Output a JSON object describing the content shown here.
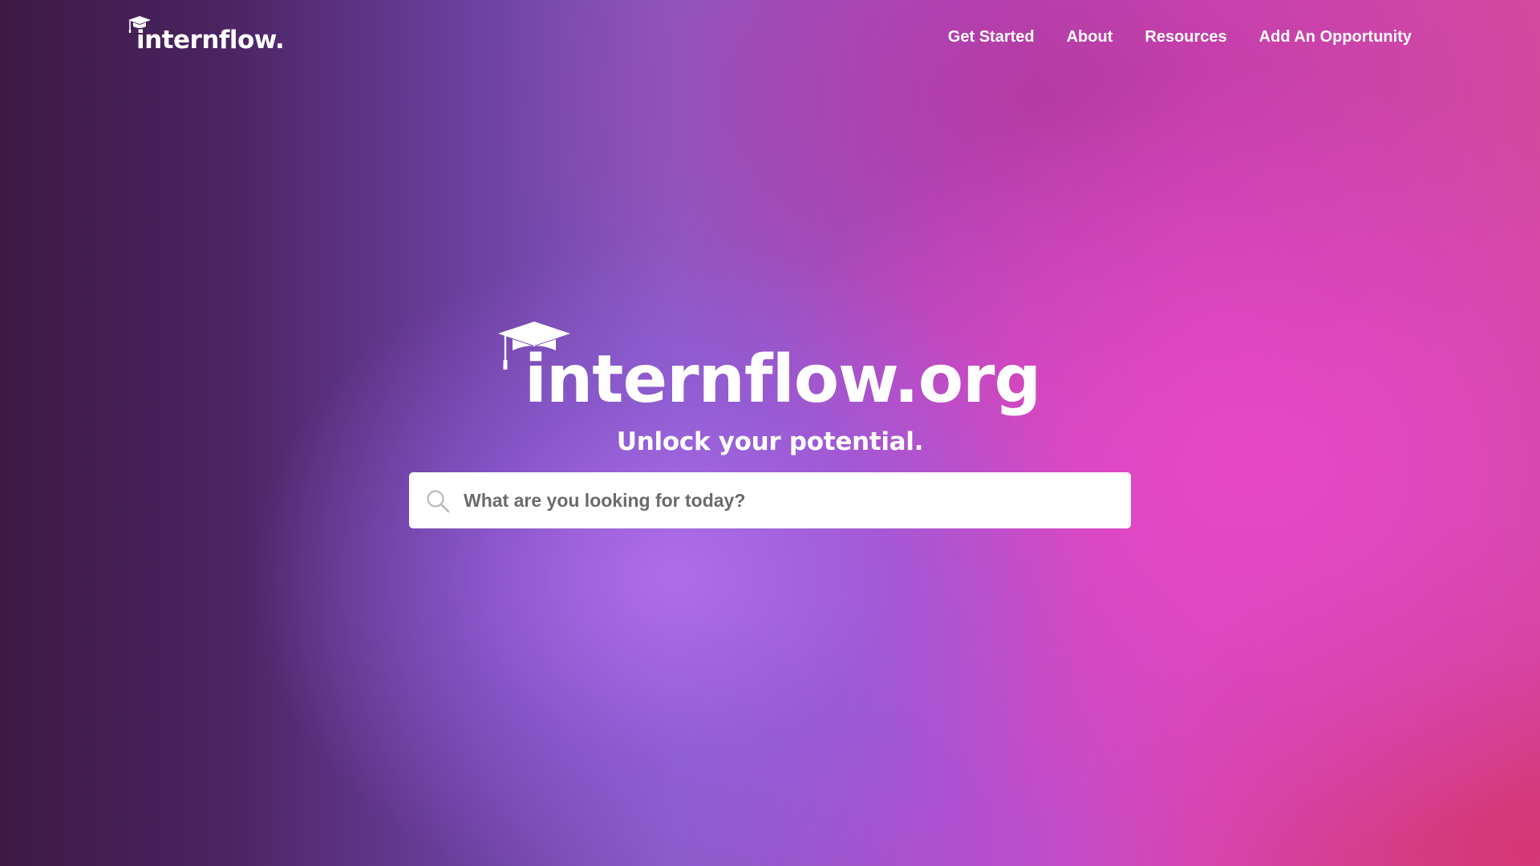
{
  "brand": {
    "wordmark": "internflow.",
    "icon": "graduation-cap-icon"
  },
  "nav": {
    "items": [
      {
        "label": "Get Started"
      },
      {
        "label": "About"
      },
      {
        "label": "Resources"
      },
      {
        "label": "Add An Opportunity"
      }
    ]
  },
  "hero": {
    "title": "internflow.org",
    "title_icon": "graduation-cap-icon",
    "tagline": "Unlock your potential."
  },
  "search": {
    "icon": "search-icon",
    "value": "",
    "placeholder": "What are you looking for today?"
  },
  "colors": {
    "text": "#ffffff",
    "gradient_dark": "#3d1a44",
    "gradient_violet": "#a967e4",
    "gradient_magenta": "#e048c6",
    "gradient_red": "#d4385e",
    "search_bg": "#ffffff",
    "search_placeholder": "#6b6b6b"
  }
}
